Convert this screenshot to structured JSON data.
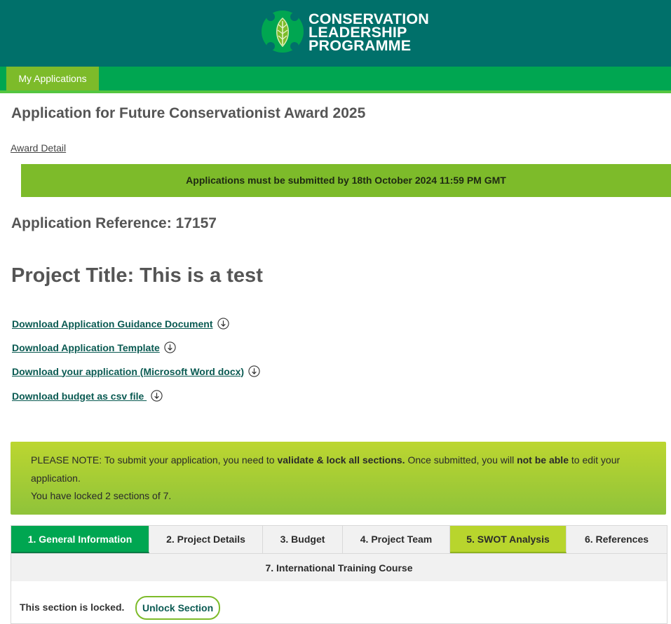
{
  "brand": {
    "line1": "CONSERVATION",
    "line2": "LEADERSHIP",
    "line3": "PROGRAMME",
    "header_color": "#00706a",
    "accent": "#00a651",
    "lime": "#7dbb2a"
  },
  "nav": {
    "tab_label": "My Applications"
  },
  "page": {
    "title": "Application for Future Conservationist Award 2025",
    "award_link": "Award Detail",
    "deadline": "Applications must be submitted by 18th October 2024 11:59 PM GMT",
    "reference": "Application Reference: 17157",
    "project_title": "Project Title: This is a test"
  },
  "downloads": [
    {
      "label": "Download Application Guidance Document",
      "icon": "download-circle-icon"
    },
    {
      "label": "Download Application Template",
      "icon": "download-circle-icon"
    },
    {
      "label": "Download your application (Microsoft Word docx)",
      "icon": "download-circle-icon"
    },
    {
      "label": "Download budget as csv file ",
      "icon": "download-circle-icon"
    }
  ],
  "note": {
    "prefix": "PLEASE NOTE: To submit your application, you need to ",
    "bold1": "validate & lock all sections.",
    "middle": " Once submitted, you will ",
    "bold2": "not be able",
    "suffix": " to edit your",
    "line2": "application.",
    "line3": "You have locked 2 sections of 7."
  },
  "tabs": [
    {
      "label": "1. General Information",
      "state": "active"
    },
    {
      "label": "2. Project Details",
      "state": "normal"
    },
    {
      "label": "3. Budget",
      "state": "normal"
    },
    {
      "label": "4. Project Team",
      "state": "normal"
    },
    {
      "label": "5. SWOT Analysis",
      "state": "locked"
    },
    {
      "label": "6. References",
      "state": "normal"
    },
    {
      "label": "7. International Training Course",
      "state": "normal"
    }
  ],
  "section": {
    "status": "This section is locked.",
    "unlock_label": "Unlock Section"
  }
}
